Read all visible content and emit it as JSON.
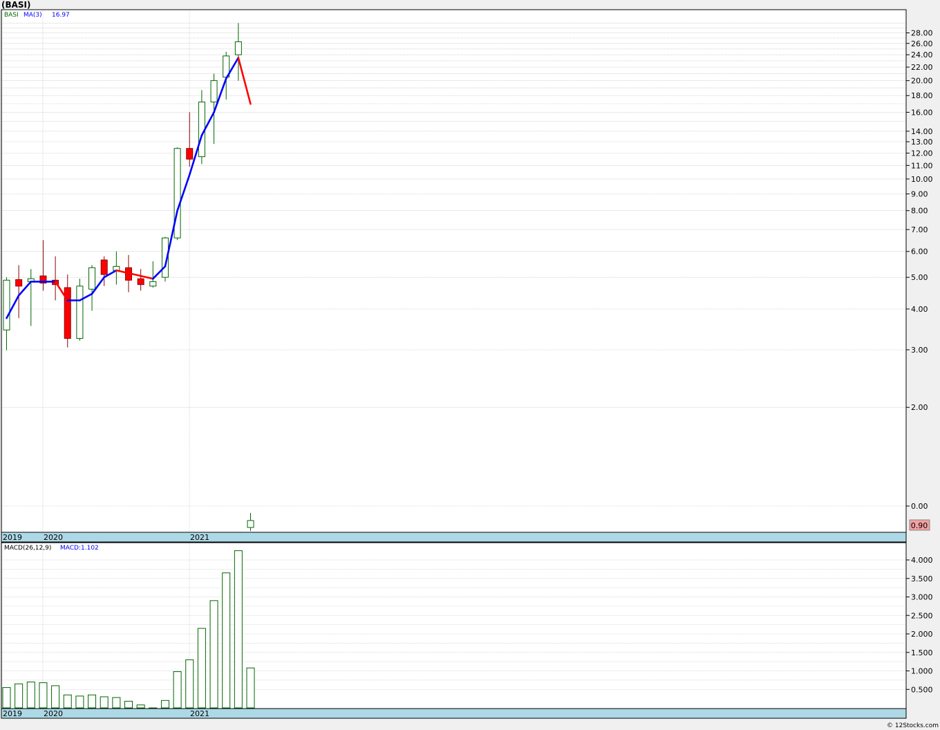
{
  "header": {
    "symbol_title": "(BASI)"
  },
  "footer": {
    "copyright": "© 12Stocks.com"
  },
  "colors": {
    "up_candle_stroke": "#006400",
    "down_candle_fill": "#ff0000",
    "ma_up": "#0000ff",
    "ma_down": "#ff0000",
    "macd_bar": "#006400",
    "date_band": "#add8e6",
    "last_price_bg": "#f4a0a0"
  },
  "chart_data": [
    {
      "type": "candlestick",
      "title": "(BASI)",
      "legend": [
        {
          "label": "BASI",
          "color": "#006400"
        },
        {
          "label": "MA(3)",
          "color": "#0000ff"
        },
        {
          "label": "16.97",
          "color": "#0000ff"
        }
      ],
      "y_scale": "log",
      "y_ticks": [
        "28.00",
        "26.00",
        "24.00",
        "22.00",
        "20.00",
        "18.00",
        "16.00",
        "14.00",
        "13.00",
        "12.00",
        "11.00",
        "10.00",
        "9.00",
        "8.00",
        "7.00",
        "6.00",
        "5.00",
        "4.00",
        "3.00",
        "2.00",
        "0.00"
      ],
      "x_labels": [
        "2019",
        "2020",
        "2021"
      ],
      "last_price_label": "0.90",
      "ohlc": [
        {
          "o": 3.45,
          "h": 5.0,
          "l": 2.99,
          "c": 4.9
        },
        {
          "o": 4.92,
          "h": 5.45,
          "l": 3.75,
          "c": 4.7
        },
        {
          "o": 4.85,
          "h": 5.3,
          "l": 3.55,
          "c": 4.95
        },
        {
          "o": 5.05,
          "h": 6.5,
          "l": 4.55,
          "c": 4.8
        },
        {
          "o": 4.9,
          "h": 5.8,
          "l": 4.25,
          "c": 4.75
        },
        {
          "o": 4.65,
          "h": 5.1,
          "l": 3.05,
          "c": 3.25
        },
        {
          "o": 3.25,
          "h": 4.95,
          "l": 3.2,
          "c": 4.7
        },
        {
          "o": 4.6,
          "h": 5.45,
          "l": 3.95,
          "c": 5.35
        },
        {
          "o": 5.65,
          "h": 5.8,
          "l": 4.7,
          "c": 5.1
        },
        {
          "o": 5.25,
          "h": 6.0,
          "l": 4.75,
          "c": 5.4
        },
        {
          "o": 5.35,
          "h": 5.85,
          "l": 4.5,
          "c": 4.9
        },
        {
          "o": 4.95,
          "h": 5.3,
          "l": 4.55,
          "c": 4.75
        },
        {
          "o": 4.7,
          "h": 5.6,
          "l": 4.65,
          "c": 4.85
        },
        {
          "o": 5.0,
          "h": 6.65,
          "l": 4.85,
          "c": 6.6
        },
        {
          "o": 6.6,
          "h": 12.5,
          "l": 6.5,
          "c": 12.4
        },
        {
          "o": 12.4,
          "h": 16.0,
          "l": 10.9,
          "c": 11.5
        },
        {
          "o": 11.7,
          "h": 18.7,
          "l": 11.1,
          "c": 17.2
        },
        {
          "o": 17.2,
          "h": 21.0,
          "l": 12.8,
          "c": 20.0
        },
        {
          "o": 20.5,
          "h": 24.5,
          "l": 17.5,
          "c": 23.8
        },
        {
          "o": 24.0,
          "h": 30.0,
          "l": 20.0,
          "c": 26.3
        }
      ],
      "ma3": [
        3.75,
        4.4,
        4.85,
        4.85,
        4.85,
        4.25,
        4.25,
        4.45,
        5.0,
        5.25,
        5.15,
        5.05,
        4.95,
        5.4,
        8.0,
        10.3,
        13.6,
        16.0,
        20.3,
        23.5,
        16.97
      ],
      "last_bar": {
        "o": 0.88,
        "h": 1.3,
        "l": 0.45,
        "c": 0.9
      }
    },
    {
      "type": "bar",
      "title": "MACD(26,12,9)",
      "legend": [
        {
          "label": "MACD(26,12,9)",
          "color": "#000000"
        },
        {
          "label": "MACD:1.102",
          "color": "#0000ff"
        }
      ],
      "y_ticks": [
        "4.000",
        "3.500",
        "3.000",
        "2.500",
        "2.000",
        "1.500",
        "1.000",
        "0.500"
      ],
      "x_labels": [
        "2019",
        "2020",
        "2021"
      ],
      "values": [
        0.55,
        0.65,
        0.7,
        0.68,
        0.6,
        0.35,
        0.32,
        0.35,
        0.3,
        0.28,
        0.18,
        0.08,
        0.0,
        0.2,
        0.98,
        1.3,
        2.15,
        2.9,
        3.65,
        4.25,
        1.08
      ]
    }
  ]
}
